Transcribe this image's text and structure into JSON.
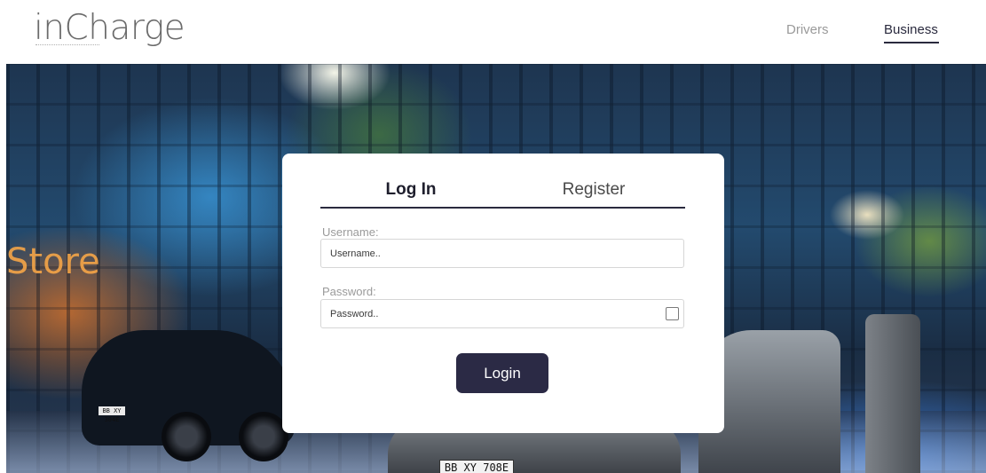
{
  "header": {
    "logo_text": "inCharge",
    "nav": [
      {
        "label": "Drivers",
        "active": false
      },
      {
        "label": "Business",
        "active": true
      }
    ]
  },
  "hero": {
    "sign_text": "Store",
    "plates": [
      "BB XY 708E",
      "BB XY 304E"
    ]
  },
  "login_card": {
    "tabs": [
      {
        "label": "Log In",
        "active": true
      },
      {
        "label": "Register",
        "active": false
      }
    ],
    "username": {
      "label": "Username:",
      "placeholder": "Username..",
      "value": ""
    },
    "password": {
      "label": "Password:",
      "placeholder": "Password..",
      "value": ""
    },
    "submit_label": "Login"
  },
  "colors": {
    "accent": "#2b2a45",
    "nav_inactive": "#9a9a9a",
    "label": "#9a9a9a"
  },
  "icons": {
    "show_password": "checkbox-square-icon"
  }
}
